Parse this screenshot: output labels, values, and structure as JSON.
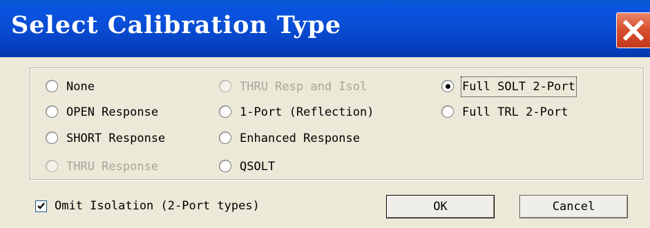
{
  "window": {
    "title": "Select Calibration Type"
  },
  "options": {
    "none": {
      "label": "None",
      "checked": false,
      "enabled": true
    },
    "open_response": {
      "label": "OPEN Response",
      "checked": false,
      "enabled": true
    },
    "short_response": {
      "label": "SHORT Response",
      "checked": false,
      "enabled": true
    },
    "thru_response": {
      "label": "THRU Response",
      "checked": false,
      "enabled": false
    },
    "thru_resp_isol": {
      "label": "THRU Resp and Isol",
      "checked": false,
      "enabled": false
    },
    "one_port": {
      "label": "1-Port (Reflection)",
      "checked": false,
      "enabled": true
    },
    "enhanced_response": {
      "label": "Enhanced Response",
      "checked": false,
      "enabled": true
    },
    "qsolt": {
      "label": "QSOLT",
      "checked": false,
      "enabled": true
    },
    "full_solt": {
      "label": "Full SOLT 2-Port",
      "checked": true,
      "enabled": true
    },
    "full_trl": {
      "label": "Full TRL 2-Port",
      "checked": false,
      "enabled": true
    }
  },
  "omit_isolation": {
    "label": "Omit Isolation (2-Port types)",
    "checked": true
  },
  "buttons": {
    "ok": "OK",
    "cancel": "Cancel"
  },
  "icons": {
    "close": "close-icon",
    "check": "checkmark-icon"
  },
  "colors": {
    "title_bar": "#0a4fd8",
    "close_button": "#d9522f",
    "dialog_bg": "#ece9d8"
  }
}
